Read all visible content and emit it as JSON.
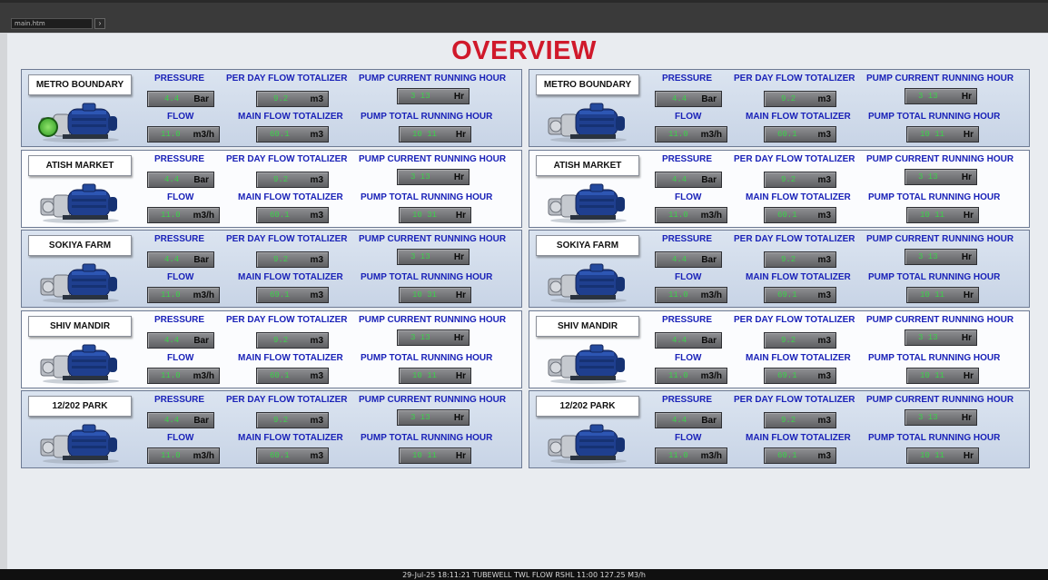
{
  "browser": {
    "address": "main.htm",
    "go_label": "›"
  },
  "title": "OVERVIEW",
  "labels": {
    "pressure": "PRESSURE",
    "flow": "FLOW",
    "per_day": "PER DAY FLOW TOTALIZER",
    "main_flow": "MAIN FLOW TOTALIZER",
    "pump_current": "PUMP CURRENT RUNNING HOUR",
    "pump_total": "PUMP TOTAL RUNNING HOUR"
  },
  "units": {
    "bar": "Bar",
    "m3h": "m3/h",
    "m3": "m3",
    "hr": "Hr"
  },
  "stations": [
    {
      "name": "METRO BOUNDARY",
      "pressure": "4.4",
      "flow": "11.0",
      "per_day": "9.2",
      "main_flow": "60.1",
      "cur_hr": "3   13",
      "tot_hr": "10   11"
    },
    {
      "name": "ATISH MARKET",
      "pressure": "4.4",
      "flow": "11.0",
      "per_day": "9.2",
      "main_flow": "60.1",
      "cur_hr": "3   13",
      "tot_hr": "10   31"
    },
    {
      "name": "SOKIYA FARM",
      "pressure": "4.4",
      "flow": "11.0",
      "per_day": "9.2",
      "main_flow": "69.1",
      "cur_hr": "3   13",
      "tot_hr": "10   31"
    },
    {
      "name": "SHIV MANDIR",
      "pressure": "4.4",
      "flow": "11.0",
      "per_day": "9.2",
      "main_flow": "60.1",
      "cur_hr": "3   13",
      "tot_hr": "10   11"
    },
    {
      "name": "12/202 PARK",
      "pressure": "4.4",
      "flow": "11.0",
      "per_day": "9.2",
      "main_flow": "60.1",
      "cur_hr": "3   13",
      "tot_hr": "10   11"
    },
    {
      "name": "METRO BOUNDARY",
      "pressure": "4.4",
      "flow": "11.0",
      "per_day": "9.2",
      "main_flow": "60.1",
      "cur_hr": "3   13",
      "tot_hr": "10   11"
    },
    {
      "name": "ATISH MARKET",
      "pressure": "4.4",
      "flow": "11.0",
      "per_day": "9.2",
      "main_flow": "60.1",
      "cur_hr": "3   13",
      "tot_hr": "10   11"
    },
    {
      "name": "SOKIYA FARM",
      "pressure": "4.4",
      "flow": "11.0",
      "per_day": "9.2",
      "main_flow": "69.1",
      "cur_hr": "3   13",
      "tot_hr": "10   11"
    },
    {
      "name": "SHIV MANDIR",
      "pressure": "4.4",
      "flow": "11.0",
      "per_day": "9.2",
      "main_flow": "69.1",
      "cur_hr": "3   13",
      "tot_hr": "10   11"
    },
    {
      "name": "12/202 PARK",
      "pressure": "4.4",
      "flow": "11.0",
      "per_day": "9.2",
      "main_flow": "60.1",
      "cur_hr": "3   13",
      "tot_hr": "10   11"
    }
  ],
  "status_bar": "29-Jul-25  18:11:21  TUBEWELL  TWL FLOW  RSHL  11:00 127.25  M3/h"
}
